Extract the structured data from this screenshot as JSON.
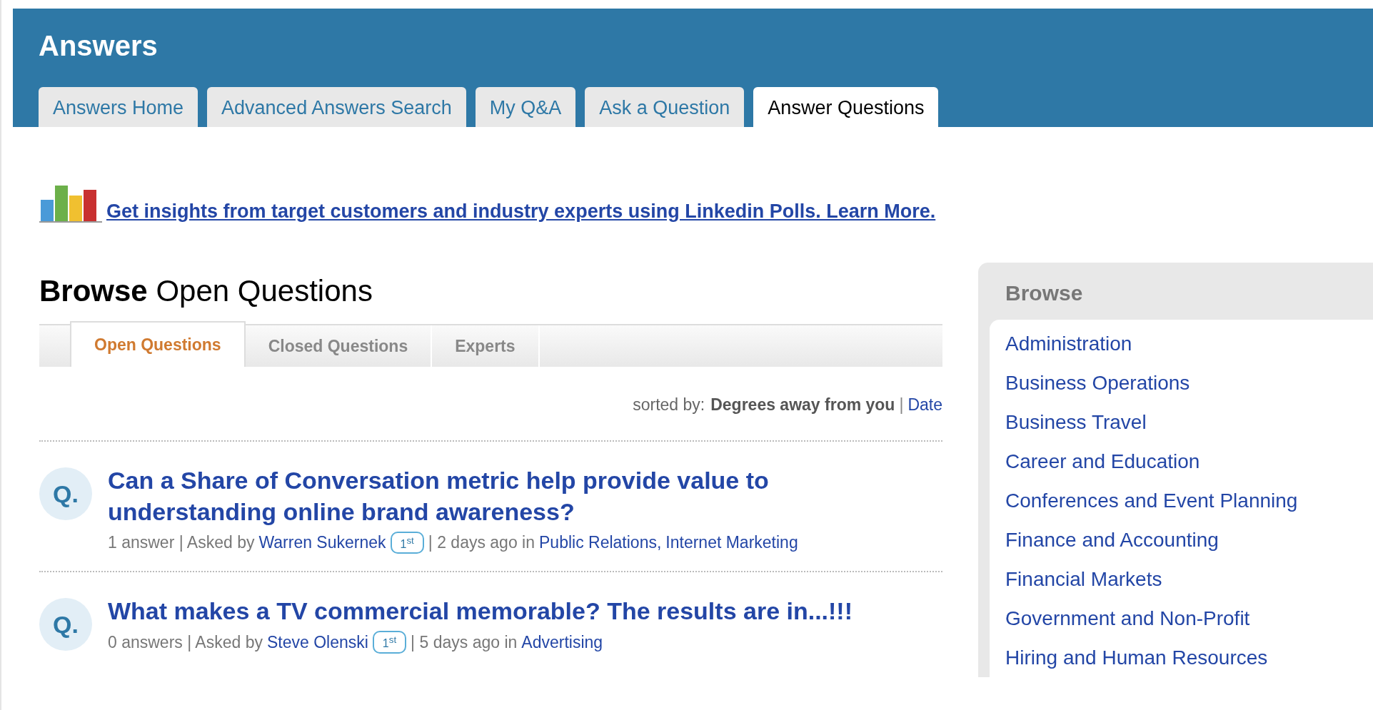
{
  "header": {
    "title": "Answers"
  },
  "tabs": [
    {
      "label": "Answers Home",
      "selected": false
    },
    {
      "label": "Advanced Answers Search",
      "selected": false
    },
    {
      "label": "My Q&A",
      "selected": false
    },
    {
      "label": "Ask a Question",
      "selected": false
    },
    {
      "label": "Answer Questions",
      "selected": true
    }
  ],
  "promo": {
    "link": "Get insights from target customers and industry experts using Linkedin Polls. Learn More."
  },
  "heading": "**Browse** Open Questions",
  "subtabs": [
    {
      "label": "Open Questions",
      "selected": true
    },
    {
      "label": "Closed Questions",
      "selected": false
    },
    {
      "label": "Experts",
      "selected": false
    }
  ],
  "sort": {
    "label": "sorted by:",
    "separator": "|",
    "options": [
      {
        "label": "Degrees away from you",
        "selected": true
      },
      {
        "label": "Date",
        "selected": false
      }
    ]
  },
  "questions": [
    {
      "marker": "Q.",
      "title": "Can a Share of Conversation metric help provide value to understanding online brand awareness?",
      "answers": "1 answer | Asked by",
      "author": "Warren Sukernek",
      "degree": "1$^{st}$",
      "age": "| 2 days ago in",
      "categories": [
        "Public Relations,",
        "Internet Marketing"
      ]
    },
    {
      "marker": "Q.",
      "title": "What makes a TV commercial memorable? The results are in...!!!",
      "answers": "0 answers | Asked by",
      "author": "Steve Olenski",
      "degree": "1$^{st}$",
      "age": "| 5 days ago in",
      "categories": [
        "Advertising"
      ]
    }
  ],
  "sidebar": {
    "title": "Browse",
    "items": [
      "Administration",
      "Business Operations",
      "Business Travel",
      "Career and Education",
      "Conferences and Event Planning",
      "Finance and Accounting",
      "Financial Markets",
      "Government and Non-Profit",
      "Hiring and Human Resources"
    ]
  }
}
